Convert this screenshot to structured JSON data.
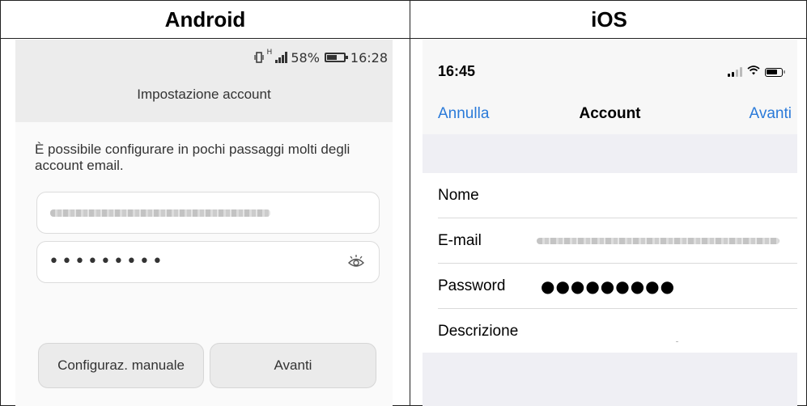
{
  "columns": {
    "android_title": "Android",
    "ios_title": "iOS"
  },
  "android": {
    "status_bar": {
      "signal_prefix": "↿‡",
      "network": "H",
      "battery_percent": "58%",
      "time": "16:28",
      "icons": [
        "vibrate-icon",
        "signal-icon",
        "battery-icon"
      ]
    },
    "title": "Impostazione account",
    "description": "È possibile configurare in pochi passaggi molti degli account email.",
    "email_field": {
      "value_hidden": true
    },
    "password_field": {
      "masked_value": "•••••••••",
      "icon": "eye-icon"
    },
    "buttons": {
      "manual": "Configuraz. manuale",
      "next": "Avanti"
    },
    "colors": {
      "topbar_bg": "#ececec",
      "button_bg": "#ebebeb"
    }
  },
  "ios": {
    "status_bar": {
      "time": "16:45",
      "icons": [
        "signal-icon",
        "wifi-icon",
        "battery-icon"
      ]
    },
    "nav": {
      "left": "Annulla",
      "title": "Account",
      "right": "Avanti"
    },
    "rows": [
      {
        "label": "Nome"
      },
      {
        "label": "E-mail",
        "value_hidden": true
      },
      {
        "label": "Password",
        "masked_value": "●●●●●●●●●"
      },
      {
        "label": "Descrizione"
      }
    ],
    "colors": {
      "accent": "#2a7ad9",
      "group_bg": "#efeff4"
    }
  }
}
